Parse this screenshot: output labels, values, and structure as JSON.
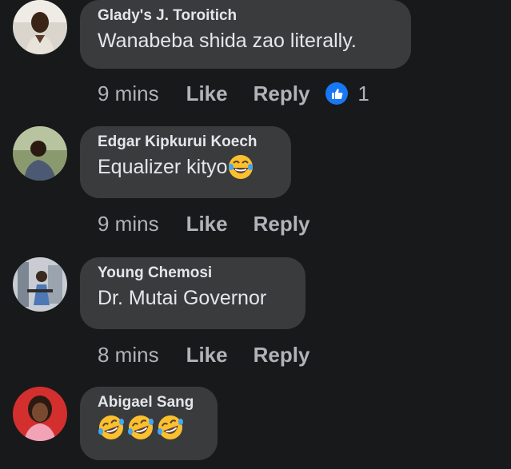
{
  "comments": [
    {
      "author": "Glady's J. Toroitich",
      "text": "Wanabeba shida zao literally.",
      "time": "9 mins",
      "like_label": "Like",
      "reply_label": "Reply",
      "reaction_icon": "like-reaction-icon",
      "reaction_count": "1",
      "avatar_icon": "avatar-woman-white-top",
      "text_emoji": []
    },
    {
      "author": "Edgar Kipkurui Koech",
      "text": "Equalizer kityo",
      "time": "9 mins",
      "like_label": "Like",
      "reply_label": "Reply",
      "avatar_icon": "avatar-man-outdoors",
      "text_emoji": [
        "tears-of-joy-emoji"
      ]
    },
    {
      "author": "Young Chemosi",
      "text": "Dr. Mutai Governor",
      "time": "8 mins",
      "like_label": "Like",
      "reply_label": "Reply",
      "avatar_icon": "avatar-gym-photo",
      "text_emoji": []
    },
    {
      "author": "Abigael Sang",
      "text": "",
      "avatar_icon": "avatar-woman-red-background",
      "text_emoji": [
        "rolling-laughing-emoji",
        "rolling-laughing-emoji",
        "rolling-laughing-emoji"
      ]
    }
  ],
  "colors": {
    "background": "#18191a",
    "bubble": "#3a3b3c",
    "primary_text": "#e4e6eb",
    "secondary_text": "#b0b3b8",
    "like_blue": "#1877f2"
  }
}
